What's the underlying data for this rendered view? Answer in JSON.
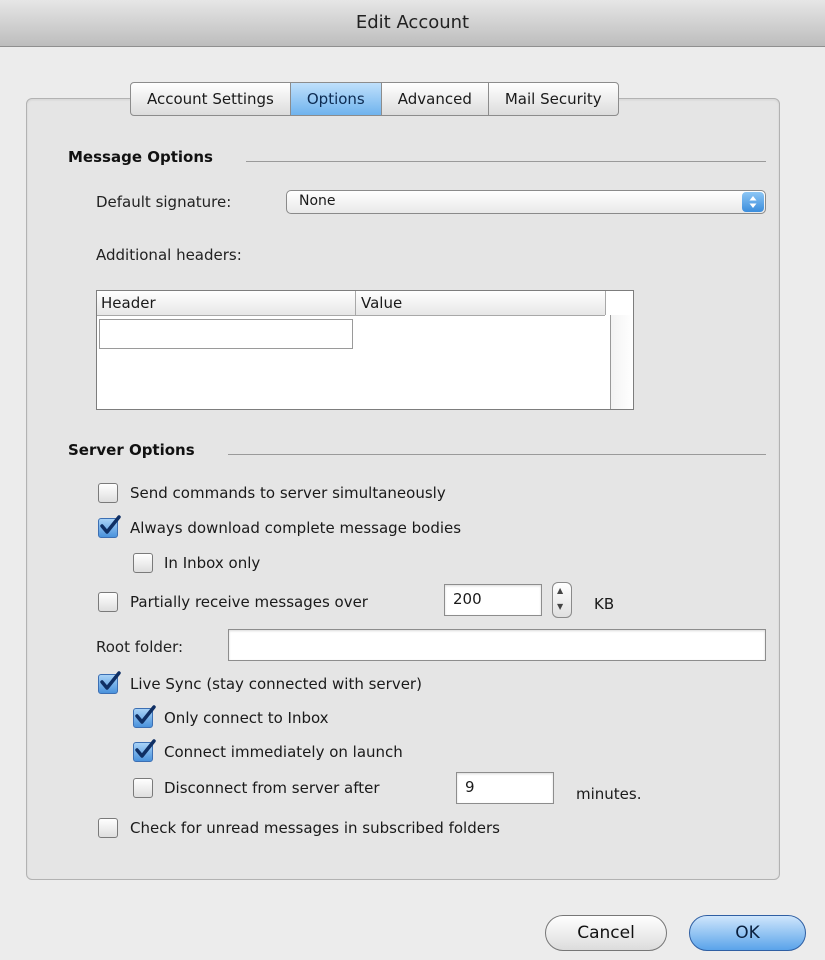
{
  "window": {
    "title": "Edit Account"
  },
  "tabs": [
    {
      "label": "Account Settings",
      "active": false
    },
    {
      "label": "Options",
      "active": true
    },
    {
      "label": "Advanced",
      "active": false
    },
    {
      "label": "Mail Security",
      "active": false
    }
  ],
  "message_options": {
    "title": "Message Options",
    "default_signature_label": "Default signature:",
    "default_signature_value": "None",
    "additional_headers_label": "Additional headers:",
    "table": {
      "columns": [
        "Header",
        "Value"
      ],
      "rows": []
    }
  },
  "server_options": {
    "title": "Server Options",
    "send_commands": {
      "label": "Send commands to server simultaneously",
      "checked": false
    },
    "always_download": {
      "label": "Always download complete message bodies",
      "checked": true
    },
    "inbox_only": {
      "label": "In Inbox only",
      "checked": false
    },
    "partially_receive": {
      "label": "Partially receive messages over",
      "checked": false,
      "value": "200",
      "unit": "KB"
    },
    "root_folder": {
      "label": "Root folder:",
      "value": ""
    },
    "live_sync": {
      "label": "Live Sync (stay connected with server)",
      "checked": true
    },
    "only_connect_inbox": {
      "label": "Only connect to Inbox",
      "checked": true
    },
    "connect_immediately": {
      "label": "Connect immediately on launch",
      "checked": true
    },
    "disconnect_after": {
      "label": "Disconnect from server after",
      "checked": false,
      "value": "9",
      "unit": "minutes."
    },
    "check_unread": {
      "label": "Check for unread messages in subscribed folders",
      "checked": false
    }
  },
  "buttons": {
    "cancel": "Cancel",
    "ok": "OK"
  }
}
